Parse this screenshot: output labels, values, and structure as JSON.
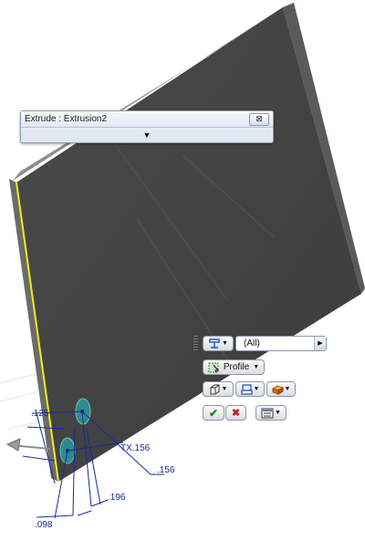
{
  "dialog": {
    "title": "Extrude : Extrusion2",
    "close_glyph": "⊠",
    "expand_glyph": "▼"
  },
  "mini_toolbar": {
    "filter_value": "(All)",
    "profile_label": "Profile",
    "dropdown_glyph": "▼",
    "scroll_glyph": "▶",
    "ok_glyph": "✔",
    "cancel_glyph": "✖"
  },
  "dimensions": {
    "d1": ".125",
    "d2": "TX.156",
    "d3": ".156",
    "d4": ".196",
    "d5": ".098"
  },
  "colors": {
    "plate_face": "#454545",
    "plate_top": "#8e8e8e",
    "plate_edge": "#6b6b6b",
    "highlight_edge": "#f2ec1c",
    "dimension": "#1a2a9c",
    "hole_fill": "#2f8a8a",
    "ok_green": "#1b8c1b",
    "cancel_red": "#c42020"
  },
  "icons": [
    "grip-icon",
    "direction-icon",
    "profile-icon",
    "solid-icon",
    "output-icon",
    "operation-icon",
    "ok-icon",
    "cancel-icon",
    "options-icon"
  ]
}
